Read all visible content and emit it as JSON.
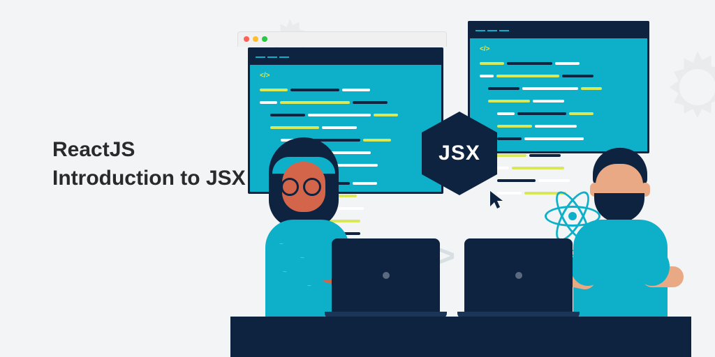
{
  "title": {
    "line1": "ReactJS",
    "line2": "Introduction to JSX"
  },
  "badge": {
    "label": "JSX"
  },
  "react_logo": {
    "label": "React JS"
  },
  "code_decoration": "< / >",
  "code_windows": {
    "tag_symbol": "</>"
  }
}
